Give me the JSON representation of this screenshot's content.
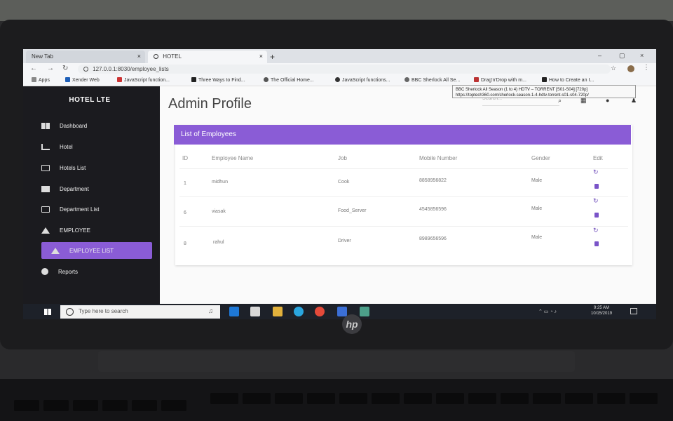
{
  "browser": {
    "tabs": [
      {
        "label": "New Tab",
        "close": "×"
      },
      {
        "label": "HOTEL",
        "close": "×"
      }
    ],
    "new_tab": "+",
    "window_controls": [
      "–",
      "▢",
      "×"
    ],
    "url": "127.0.0.1:8030/employee_lists",
    "bookmarks": [
      "Apps",
      "Xender Web",
      "JavaScript function...",
      "Three Ways to Find...",
      "The Official Home...",
      "JavaScript functions...",
      "BBC Sherlock All Se...",
      "Drag'n'Drop with m...",
      "How to Create an I..."
    ],
    "tooltip": {
      "title": "BBC Sherlock All Season (1 to 4) HDTV – TORRENT [S01-S04] [720p]",
      "url": "https://toptech360.com/sherlock-season-1-4-hdtv-torrent-s01-s04-720p/"
    }
  },
  "sidebar": {
    "brand": "HOTEL LTE",
    "items": [
      {
        "label": "Dashboard",
        "icon": "dashboard-icon"
      },
      {
        "label": "Hotel",
        "icon": "bed-icon"
      },
      {
        "label": "Hotels List",
        "icon": "clipboard-icon"
      },
      {
        "label": "Department",
        "icon": "chart-icon"
      },
      {
        "label": "Department List",
        "icon": "clipboard-icon"
      },
      {
        "label": "EMPLOYEE",
        "icon": "home-icon"
      },
      {
        "label": "EMPLOYEE LIST",
        "icon": "home-icon",
        "active": true
      },
      {
        "label": "Reports",
        "icon": "info-icon"
      }
    ]
  },
  "main": {
    "title": "Admin Profile",
    "search_placeholder": "Search...",
    "card_title": "List of Employees",
    "columns": [
      "ID",
      "Employee Name",
      "Job",
      "Mobile Number",
      "Gender",
      "Edit"
    ],
    "rows": [
      {
        "id": "1",
        "name": "midhun",
        "job": "Cook",
        "mobile": "8858956822",
        "gender": "Male"
      },
      {
        "id": "6",
        "name": "viasak",
        "job": "Food_Server",
        "mobile": "4545856596",
        "gender": "Male"
      },
      {
        "id": "8",
        "name": "rahul",
        "job": "Driver",
        "mobile": "8989656596",
        "gender": "Male"
      }
    ]
  },
  "taskbar": {
    "search_placeholder": "Type here to search",
    "time": "9:25 AM",
    "date": "10/15/2019"
  },
  "colors": {
    "accent": "#8a5cd6",
    "sidebar_bg": "#1b1b1f"
  }
}
